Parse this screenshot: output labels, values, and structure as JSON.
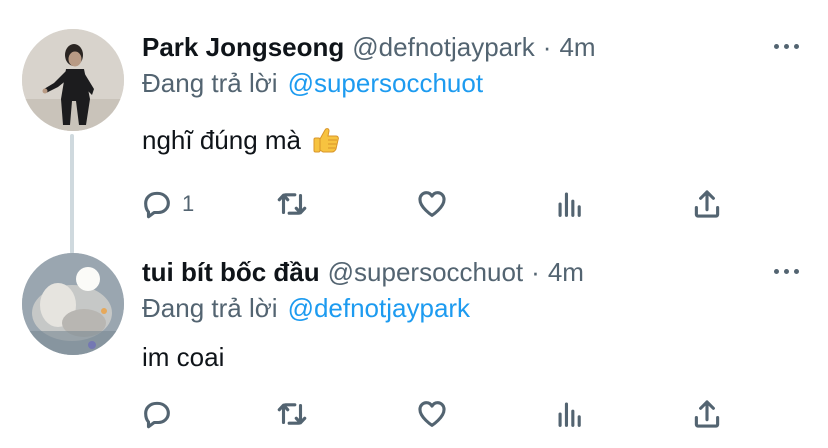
{
  "tweets": [
    {
      "display_name": "Park Jongseong",
      "handle": "@defnotjaypark",
      "separator": "·",
      "time": "4m",
      "reply_prefix": "Đang trả lời",
      "reply_to": "@supersocchuot",
      "text": "nghĩ đúng mà",
      "emoji": "thumbs-up",
      "reply_count": "1",
      "avatar": "photo-person-black-suit"
    },
    {
      "display_name": "tui bít bốc đầu",
      "handle": "@supersocchuot",
      "separator": "·",
      "time": "4m",
      "reply_prefix": "Đang trả lời",
      "reply_to": "@defnotjaypark",
      "text": "im coai",
      "reply_count": "",
      "avatar": "photo-blurry-white-object"
    }
  ],
  "icons": [
    "reply-icon",
    "retweet-icon",
    "like-icon",
    "stats-icon",
    "share-icon",
    "more-icon"
  ],
  "colors": {
    "link": "#1d9bf0",
    "secondary_text": "#536471",
    "thread_line": "#cfd9de"
  }
}
